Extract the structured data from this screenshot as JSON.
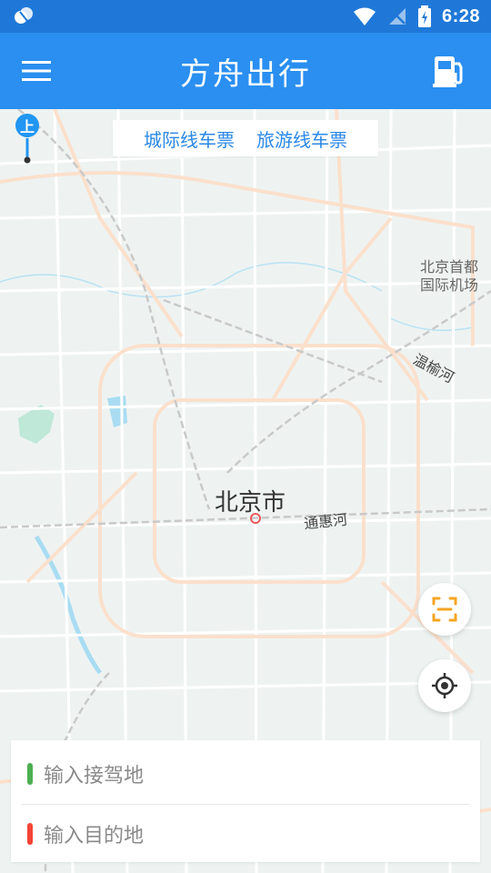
{
  "status_bar": {
    "time": "6:28"
  },
  "app_bar": {
    "title": "方舟出行"
  },
  "tabs": {
    "intercity": "城际线车票",
    "tour": "旅游线车票"
  },
  "map": {
    "pin_label": "上",
    "city": "北京市",
    "airport_line1": "北京首都",
    "airport_line2": "国际机场",
    "river_wenyu": "温榆河",
    "river_tonghui": "通惠河"
  },
  "trip": {
    "pickup_placeholder": "输入接驾地",
    "destination_placeholder": "输入目的地",
    "pickup_color": "#4caf50",
    "destination_color": "#f44336"
  },
  "colors": {
    "status_bar": "#1f78d8",
    "app_bar": "#2a8ff0",
    "accent": "#2b88e6",
    "scan_orange": "#f5a623"
  }
}
